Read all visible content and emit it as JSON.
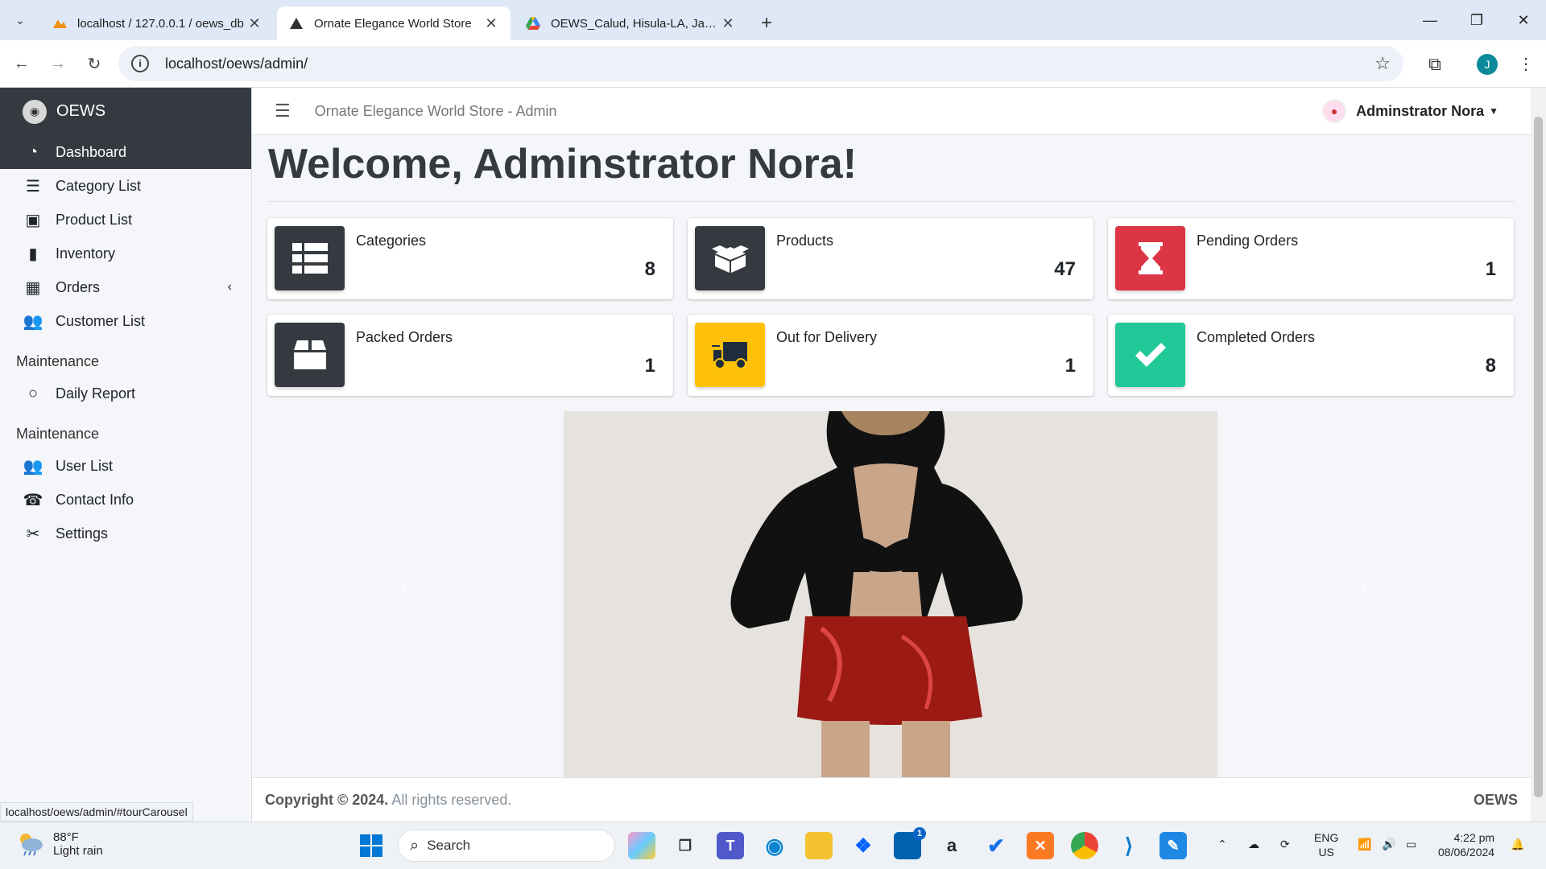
{
  "browser": {
    "tabs": [
      {
        "title": "localhost / 127.0.0.1 / oews_db",
        "active": false,
        "icon": "phpmyadmin-icon"
      },
      {
        "title": "Ornate Elegance World Store",
        "active": true,
        "icon": "oews-icon"
      },
      {
        "title": "OEWS_Calud, Hisula-LA, Jayecti",
        "active": false,
        "icon": "google-drive-icon"
      }
    ],
    "url": "localhost/oews/admin/",
    "profile_initial": "J",
    "status_url": "localhost/oews/admin/#tourCarousel"
  },
  "sidebar": {
    "brand": "OEWS",
    "items": [
      {
        "label": "Dashboard",
        "icon": "dashboard-icon",
        "active": true
      },
      {
        "label": "Category List",
        "icon": "list-icon"
      },
      {
        "label": "Product List",
        "icon": "box-icon"
      },
      {
        "label": "Inventory",
        "icon": "clipboard-icon"
      },
      {
        "label": "Orders",
        "icon": "table-icon",
        "caret": "‹"
      },
      {
        "label": "Customer List",
        "icon": "users-icon"
      }
    ],
    "section1": "Maintenance",
    "report_items": [
      {
        "label": "Daily Report",
        "icon": "circle-icon"
      }
    ],
    "section2": "Maintenance",
    "maint_items": [
      {
        "label": "User List",
        "icon": "users-cog-icon"
      },
      {
        "label": "Contact Info",
        "icon": "phone-icon"
      },
      {
        "label": "Settings",
        "icon": "tools-icon"
      }
    ]
  },
  "topnav": {
    "title": "Ornate Elegance World Store - Admin",
    "user": "Adminstrator Nora"
  },
  "main": {
    "welcome": "Welcome, Adminstrator Nora!",
    "boxes": [
      {
        "label": "Categories",
        "value": "8",
        "color": "#343a40",
        "icon": "th-list-icon"
      },
      {
        "label": "Products",
        "value": "47",
        "color": "#343a40",
        "icon": "box-open-icon"
      },
      {
        "label": "Pending Orders",
        "value": "1",
        "color": "#dc3545",
        "icon": "hourglass-icon"
      },
      {
        "label": "Packed Orders",
        "value": "1",
        "color": "#343a40",
        "icon": "box-icon"
      },
      {
        "label": "Out for Delivery",
        "value": "1",
        "color": "#ffc107",
        "icon": "truck-icon"
      },
      {
        "label": "Completed Orders",
        "value": "8",
        "color": "#20c997",
        "icon": "check-icon"
      }
    ]
  },
  "footer": {
    "copyright": "Copyright © 2024.",
    "rights": " All rights reserved.",
    "brand": "OEWS"
  },
  "taskbar": {
    "temp": "88°F",
    "weather": "Light rain",
    "search": "Search",
    "lang1": "ENG",
    "lang2": "US",
    "time": "4:22 pm",
    "date": "08/06/2024",
    "badge": "1"
  }
}
